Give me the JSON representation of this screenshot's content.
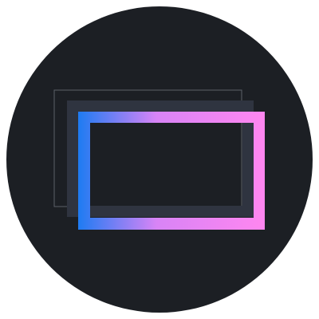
{
  "icon": {
    "name": "screen-frames-app-icon",
    "colors": {
      "circle_background": "#1c1f24",
      "gradient_start": "#1e7bf2",
      "gradient_mid": "#d884f6",
      "gradient_end": "#ff86f0",
      "back_frame_fill": "#2f3440",
      "outline_stroke": "#5b6069"
    }
  }
}
